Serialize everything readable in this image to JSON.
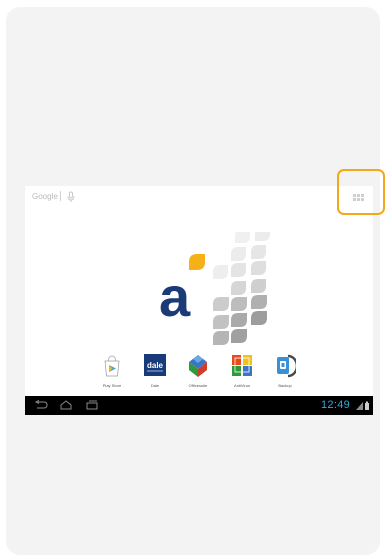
{
  "search_bar": {
    "google_label": "Google",
    "mic_icon": "microphone-icon",
    "apps_icon": "all-apps-grid-icon"
  },
  "brand": {
    "logo_letter": "a",
    "accent": "#f6b116",
    "letter_color": "#1b3b78"
  },
  "dock": {
    "apps": [
      {
        "label": "Play Store",
        "icon": "play-store-icon"
      },
      {
        "label": "Dale",
        "icon": "dale-icon",
        "text": "dale"
      },
      {
        "label": "Officesuite",
        "icon": "officesuite-icon"
      },
      {
        "label": "AntiVirus",
        "icon": "antivirus-icon"
      },
      {
        "label": "Backup",
        "icon": "backup-icon"
      }
    ]
  },
  "status_bar": {
    "time": "12:49",
    "clock_color": "#38a7d9",
    "icons": [
      "back-icon",
      "home-icon",
      "recent-apps-icon",
      "signal-icon",
      "battery-icon"
    ]
  },
  "highlight_color": "#f3a71b"
}
